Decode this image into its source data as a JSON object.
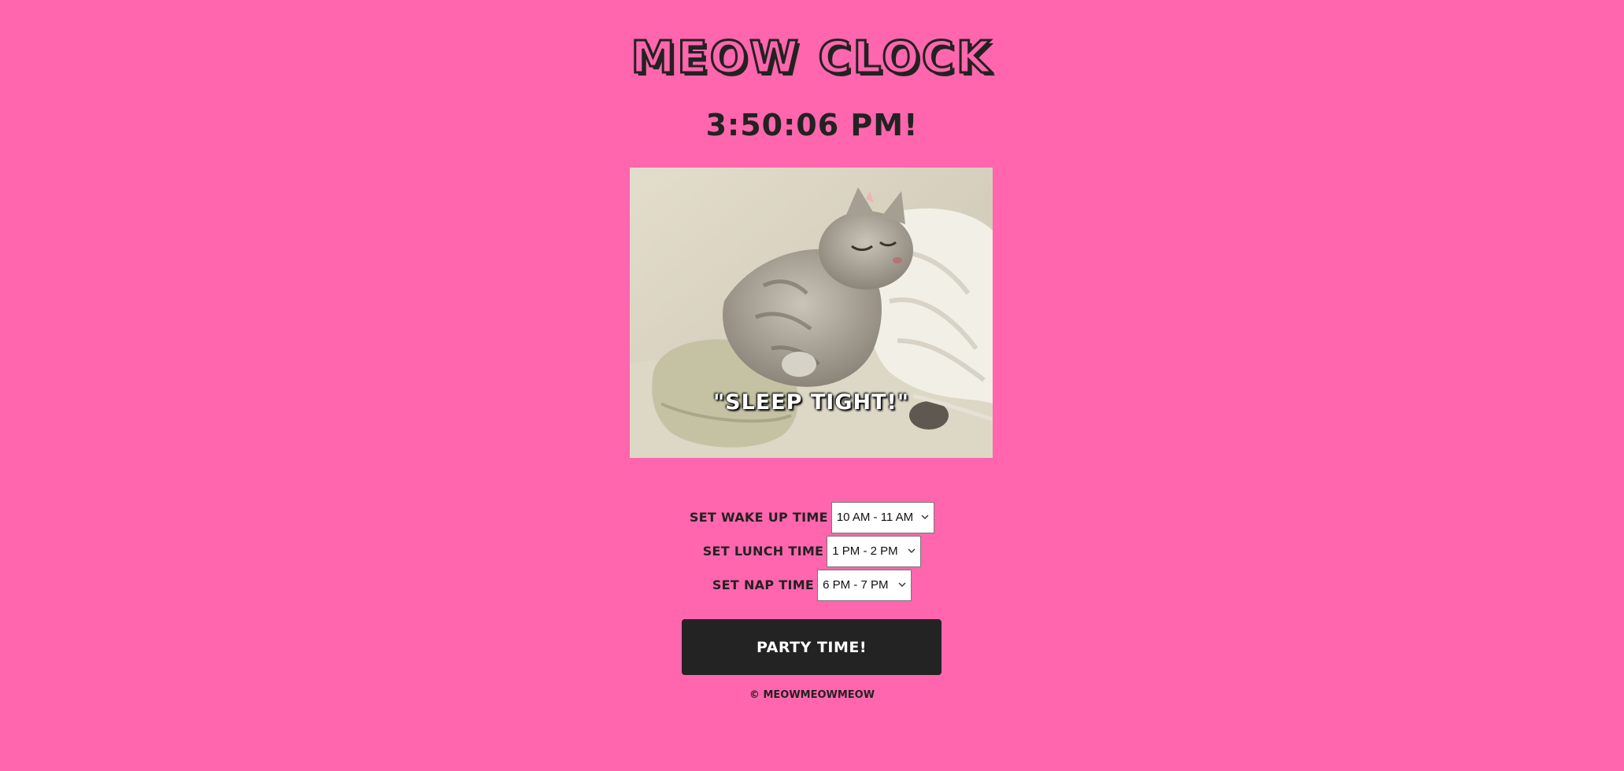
{
  "app": {
    "title": "MEOW CLOCK",
    "clock_display": "3:50:06 PM!"
  },
  "image": {
    "caption": "\"SLEEP TIGHT!\""
  },
  "controls": {
    "wake": {
      "label": "SET WAKE UP TIME",
      "value": "10 AM - 11 AM"
    },
    "lunch": {
      "label": "SET LUNCH TIME",
      "value": "1 PM - 2 PM"
    },
    "nap": {
      "label": "SET NAP TIME",
      "value": "6 PM - 7 PM"
    }
  },
  "party_button": {
    "label": "PARTY TIME!"
  },
  "footer": {
    "text": "© MEOWMEOWMEOW"
  },
  "colors": {
    "background": "#ff66ad",
    "text": "#222222",
    "button": "#232323"
  },
  "icons": {
    "select_chevron": "chevron-down-icon"
  }
}
